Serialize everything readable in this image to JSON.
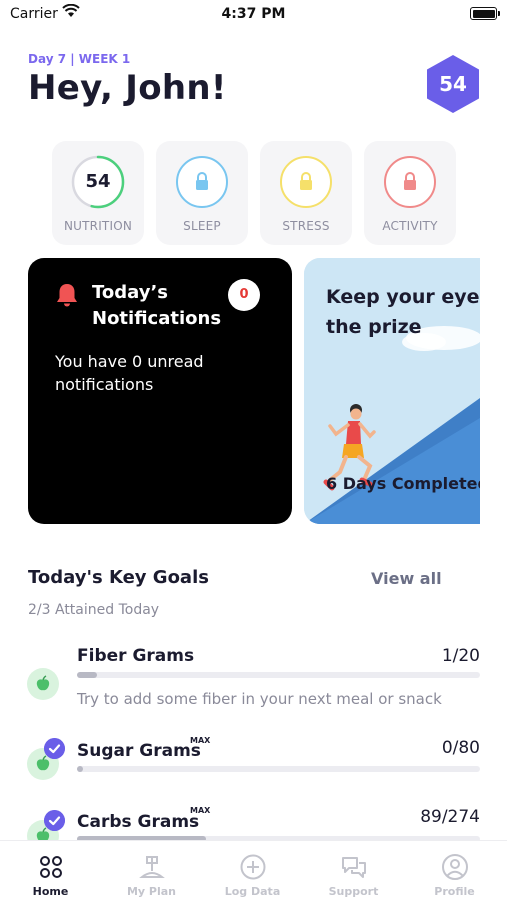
{
  "status_bar": {
    "carrier": "Carrier",
    "time": "4:37 PM"
  },
  "header": {
    "day_label": "Day 7 | WEEK 1",
    "greeting": "Hey, John!",
    "score": "54"
  },
  "categories": [
    {
      "label": "NUTRITION",
      "value": "54",
      "color": "#4cd07d",
      "progress": 0.54,
      "locked": false
    },
    {
      "label": "SLEEP",
      "color": "#79c6f0",
      "locked": true
    },
    {
      "label": "STRESS",
      "color": "#f5e06a",
      "locked": true
    },
    {
      "label": "ACTIVITY",
      "color": "#f08a8a",
      "locked": true
    }
  ],
  "notifications_card": {
    "title": "Today’s Notifications",
    "badge": "0",
    "body": "You have 0 unread notifications"
  },
  "prize_card": {
    "title_line1": "Keep your eye on",
    "title_line2": "the prize",
    "completed": "6 Days Completed"
  },
  "goals": {
    "title": "Today's Key Goals",
    "view_all": "View all",
    "subtitle": "2/3 Attained Today",
    "items": [
      {
        "name": "Fiber Grams",
        "max_tag": "",
        "value": "1/20",
        "progress": 0.05,
        "checked": false,
        "hint": "Try to add some fiber in your next meal or snack"
      },
      {
        "name": "Sugar Grams",
        "max_tag": "MAX",
        "value": "0/80",
        "progress": 0.0,
        "checked": true,
        "hint": ""
      },
      {
        "name": "Carbs Grams",
        "max_tag": "MAX",
        "value": "89/274",
        "progress": 0.32,
        "checked": true,
        "hint": ""
      }
    ]
  },
  "tabs": [
    {
      "label": "Home",
      "icon": "home-dots-icon",
      "active": true
    },
    {
      "label": "My Plan",
      "icon": "plan-icon",
      "active": false
    },
    {
      "label": "Log Data",
      "icon": "plus-circle-icon",
      "active": false
    },
    {
      "label": "Support",
      "icon": "chat-bubbles-icon",
      "active": false
    },
    {
      "label": "Profile",
      "icon": "profile-icon",
      "active": false
    }
  ],
  "colors": {
    "accent": "#6a5ee8",
    "nutrition_green": "#4cd07d",
    "goal_fill": "#b8b9c4"
  }
}
